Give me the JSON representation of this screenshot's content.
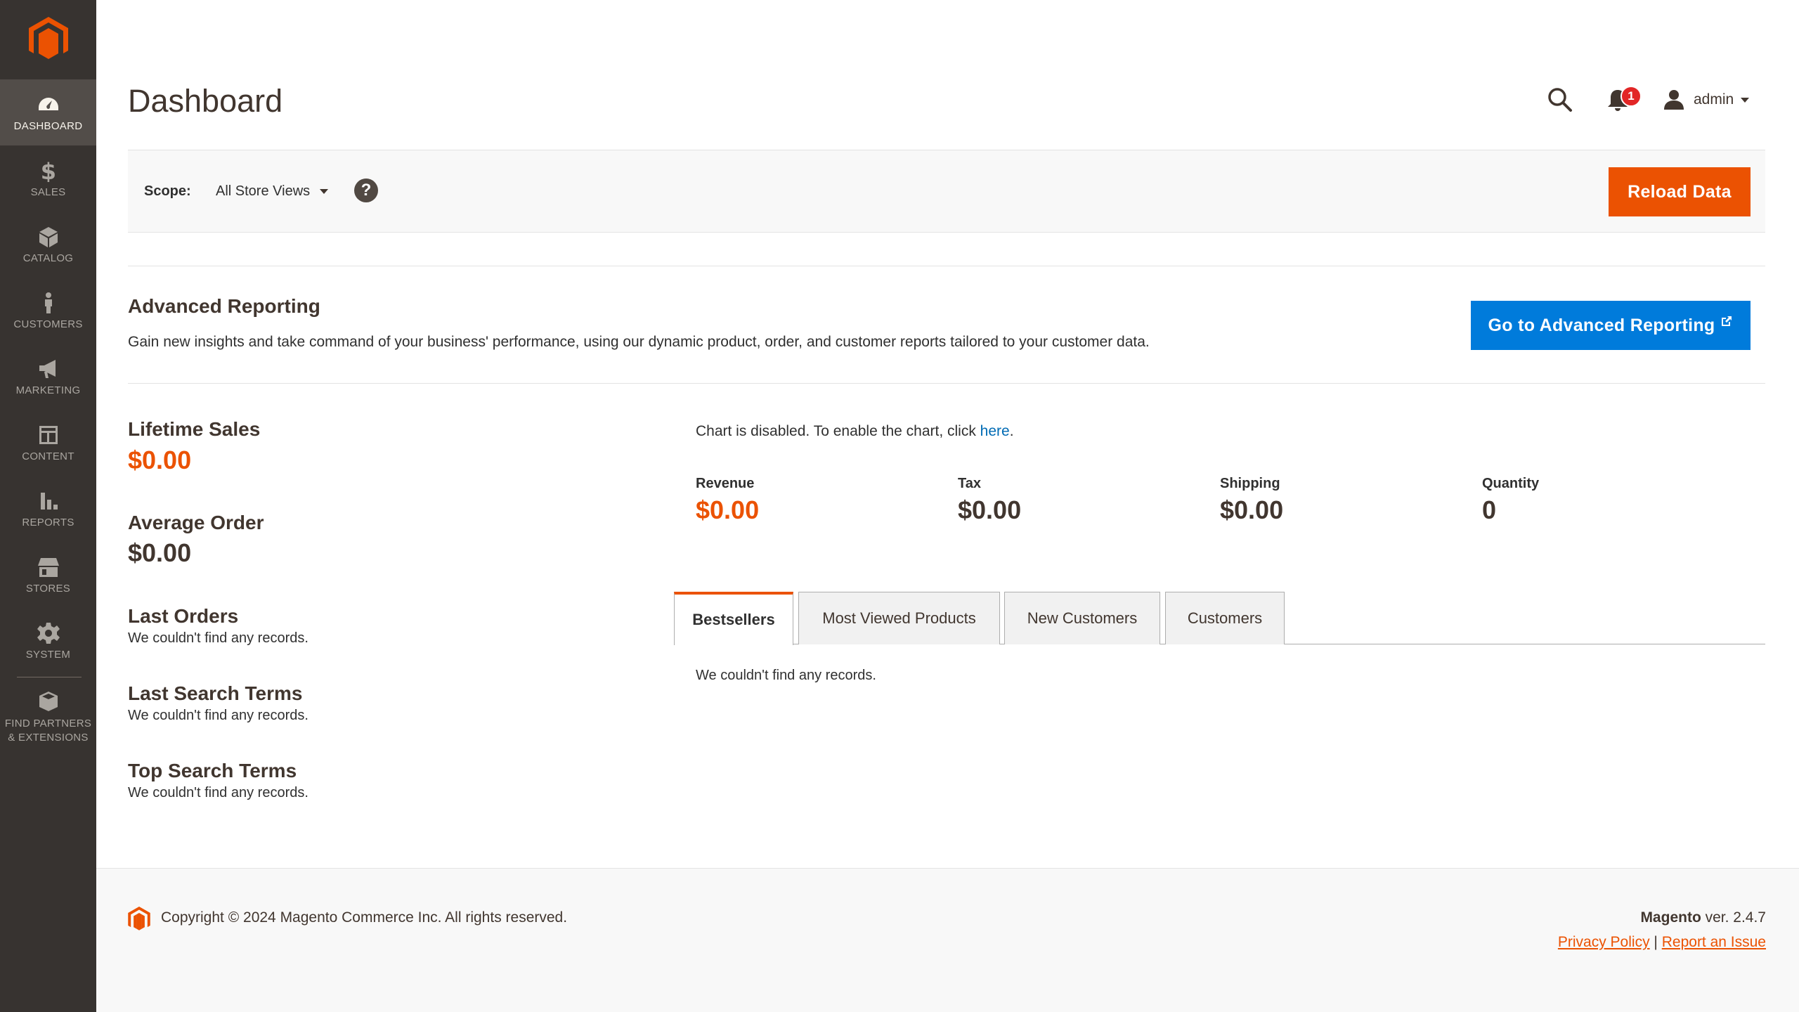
{
  "sidebar": {
    "items": [
      {
        "label": "Dashboard",
        "icon": "dashboard-icon"
      },
      {
        "label": "Sales",
        "icon": "dollar-icon"
      },
      {
        "label": "Catalog",
        "icon": "cube-icon"
      },
      {
        "label": "Customers",
        "icon": "person-icon"
      },
      {
        "label": "Marketing",
        "icon": "megaphone-icon"
      },
      {
        "label": "Content",
        "icon": "layout-icon"
      },
      {
        "label": "Reports",
        "icon": "bar-chart-icon"
      },
      {
        "label": "Stores",
        "icon": "storefront-icon"
      },
      {
        "label": "System",
        "icon": "gear-icon"
      }
    ],
    "partners_line1": "Find Partners",
    "partners_line2": "& Extensions"
  },
  "header": {
    "title": "Dashboard",
    "notification_count": "1",
    "user": "admin"
  },
  "scope": {
    "label": "Scope:",
    "value": "All Store Views",
    "help": "?",
    "reload_label": "Reload Data"
  },
  "advanced": {
    "title": "Advanced Reporting",
    "description": "Gain new insights and take command of your business' performance, using our dynamic product, order, and customer reports tailored to your customer data.",
    "button_label": "Go to Advanced Reporting"
  },
  "stats": {
    "lifetime_sales_label": "Lifetime Sales",
    "lifetime_sales_value": "$0.00",
    "average_order_label": "Average Order",
    "average_order_value": "$0.00",
    "last_orders_label": "Last Orders",
    "last_orders_empty": "We couldn't find any records.",
    "last_search_label": "Last Search Terms",
    "last_search_empty": "We couldn't find any records.",
    "top_search_label": "Top Search Terms",
    "top_search_empty": "We couldn't find any records."
  },
  "chart": {
    "message": "Chart is disabled. To enable the chart, click ",
    "link": "here",
    "suffix": "."
  },
  "metrics": [
    {
      "label": "Revenue",
      "value": "$0.00"
    },
    {
      "label": "Tax",
      "value": "$0.00"
    },
    {
      "label": "Shipping",
      "value": "$0.00"
    },
    {
      "label": "Quantity",
      "value": "0"
    }
  ],
  "tabs": [
    {
      "label": "Bestsellers"
    },
    {
      "label": "Most Viewed Products"
    },
    {
      "label": "New Customers"
    },
    {
      "label": "Customers"
    }
  ],
  "tab_content": "We couldn't find any records.",
  "footer": {
    "copyright": "Copyright © 2024 Magento Commerce Inc. All rights reserved.",
    "brand": "Magento",
    "version": " ver. 2.4.7",
    "privacy": "Privacy Policy",
    "separator": "|",
    "report": "Report an Issue"
  },
  "colors": {
    "accent": "#eb5202",
    "link": "#007bdb",
    "sidebar": "#373330"
  }
}
